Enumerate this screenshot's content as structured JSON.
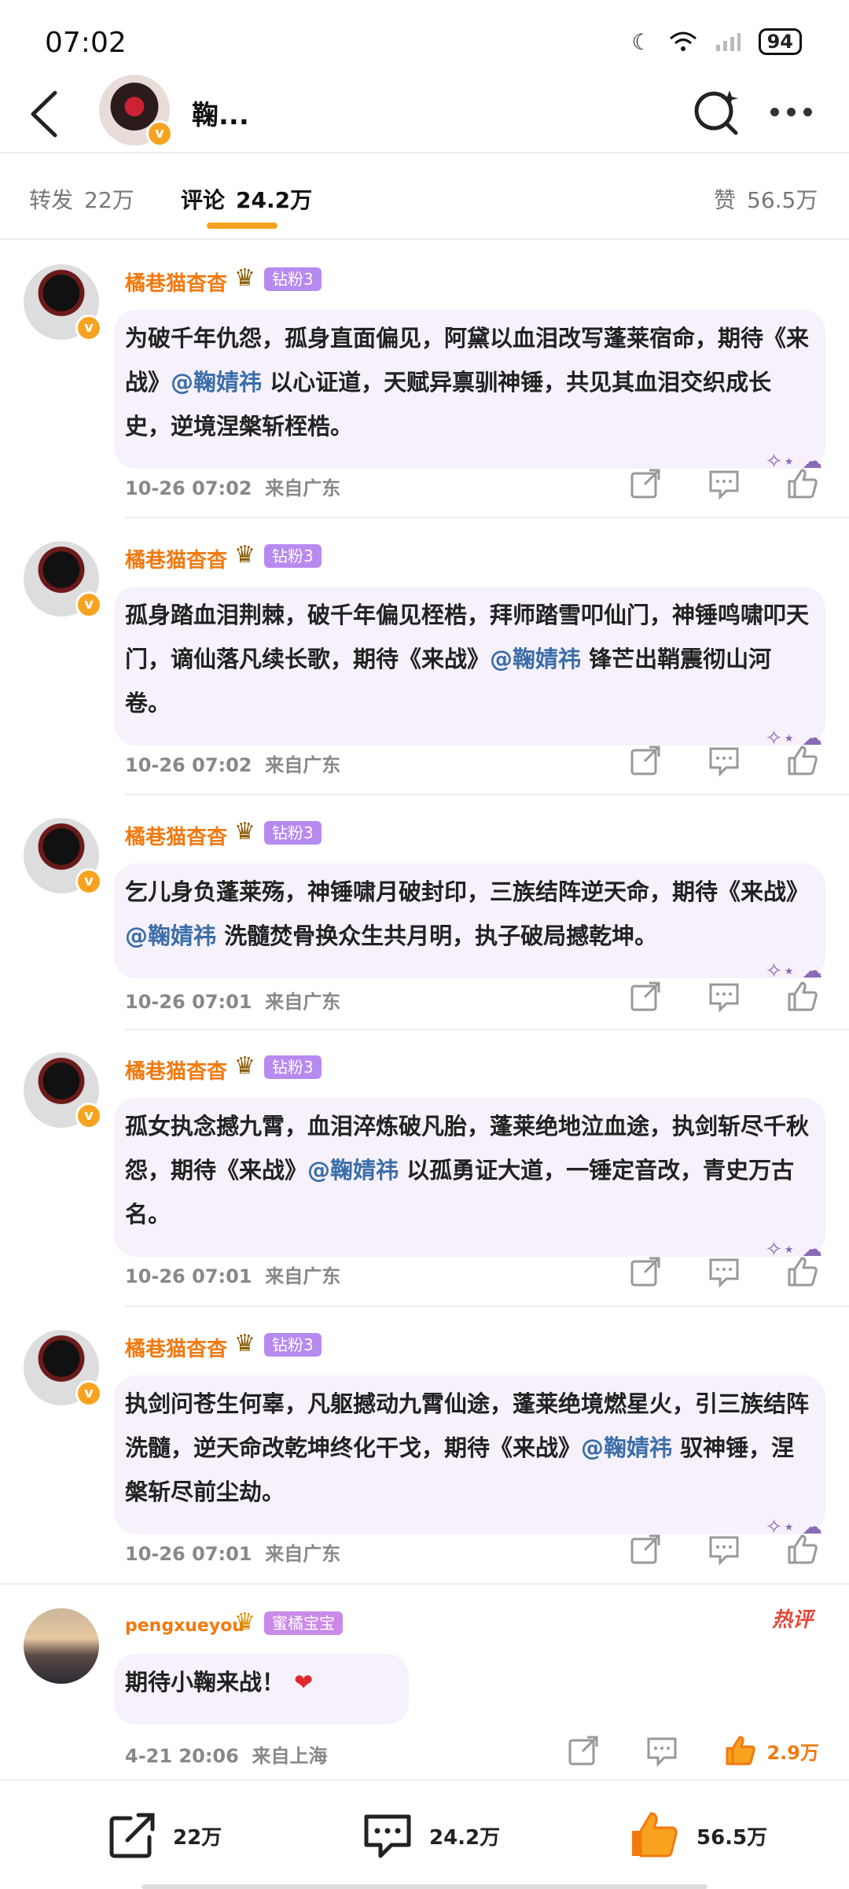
{
  "status": {
    "time": "07:02",
    "battery": "94"
  },
  "header": {
    "title": "鞠..."
  },
  "tabs": [
    {
      "label": "转发",
      "count": "22万"
    },
    {
      "label": "评论",
      "count": "24.2万"
    },
    {
      "label": "赞",
      "count": "56.5万"
    }
  ],
  "comments": [
    {
      "user": "橘巷猫杳杳",
      "badge": "钻粉3",
      "text_pre": "为破千年仇怨，孤身直面偏见，阿黛以血泪改写蓬莱宿命，期待《来战》",
      "mention": "@鞠婧祎",
      "text_post": " 以心证道，天赋异禀驯神锤，共见其血泪交织成长史，逆境涅槃斩桎梏。",
      "time": "10-26 07:02",
      "location": "来自广东"
    },
    {
      "user": "橘巷猫杳杳",
      "badge": "钻粉3",
      "text_pre": "孤身踏血泪荆棘，破千年偏见桎梏，拜师踏雪叩仙门，神锤鸣啸叩天门，谪仙落凡续长歌，期待《来战》",
      "mention": "@鞠婧祎",
      "text_post": " 锋芒出鞘震彻山河卷。",
      "time": "10-26 07:02",
      "location": "来自广东"
    },
    {
      "user": "橘巷猫杳杳",
      "badge": "钻粉3",
      "text_pre": "乞儿身负蓬莱殇，神锤啸月破封印，三族结阵逆天命，期待《来战》",
      "mention": "@鞠婧祎",
      "text_post": " 洗髓焚骨换众生共月明，执子破局撼乾坤。",
      "time": "10-26 07:01",
      "location": "来自广东"
    },
    {
      "user": "橘巷猫杳杳",
      "badge": "钻粉3",
      "text_pre": "孤女执念撼九霄，血泪淬炼破凡胎，蓬莱绝地泣血途，执剑斩尽千秋怨，期待《来战》",
      "mention": "@鞠婧祎",
      "text_post": " 以孤勇证大道，一锤定音改，青史万古名。",
      "time": "10-26 07:01",
      "location": "来自广东"
    },
    {
      "user": "橘巷猫杳杳",
      "badge": "钻粉3",
      "text_pre": "执剑问苍生何辜，凡躯撼动九霄仙途，蓬莱绝境燃星火，引三族结阵洗髓，逆天命改乾坤终化干戈，期待《来战》",
      "mention": "@鞠婧祎",
      "text_post": " 驭神锤，涅槃斩尽前尘劫。",
      "time": "10-26 07:01",
      "location": "来自广东"
    }
  ],
  "hot_comment": {
    "user": "pengxueyou",
    "badge": "蜜橘宝宝",
    "hot_label": "热评",
    "text": "期待小鞠来战！",
    "emoji": "❤",
    "time": "4-21 20:06",
    "location": "来自上海",
    "likes": "2.9万"
  },
  "bottom_bar": {
    "repost": "22万",
    "comment": "24.2万",
    "like": "56.5万"
  }
}
